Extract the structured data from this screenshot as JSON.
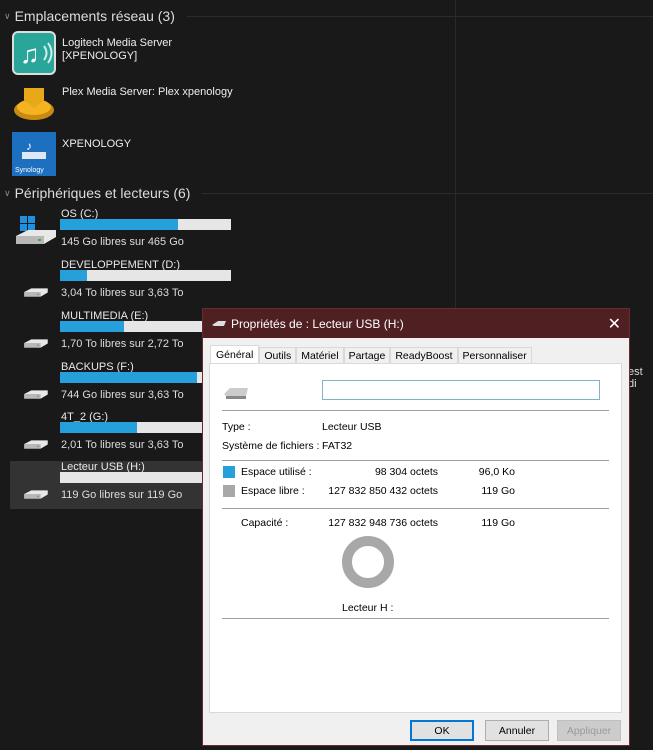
{
  "network": {
    "header": "Emplacements réseau (3)",
    "items": [
      {
        "line1": "Logitech Media Server",
        "line2": "[XPENOLOGY]",
        "icon": "logitech-media-icon"
      },
      {
        "label": "Plex Media Server: Plex xpenology",
        "icon": "plex-icon"
      },
      {
        "label": "XPENOLOGY",
        "icon": "synology-icon"
      }
    ]
  },
  "devices": {
    "header": "Périphériques et lecteurs (6)",
    "items": [
      {
        "label": "OS (C:)",
        "free": "145 Go libres sur 465 Go",
        "used_fraction": 0.69,
        "icon": "windows-drive-icon"
      },
      {
        "label": "DEVELOPPEMENT (D:)",
        "free": "3,04 To libres sur 3,63 To",
        "used_fraction": 0.16
      },
      {
        "label": "MULTIMEDIA (E:)",
        "free": "1,70 To libres sur 2,72 To",
        "used_fraction": 0.375
      },
      {
        "label": "BACKUPS (F:)",
        "free": "744 Go libres sur 3,63 To",
        "used_fraction": 0.8
      },
      {
        "label": "4T_2 (G:)",
        "free": "2,01 To libres sur 3,63 To",
        "used_fraction": 0.45
      },
      {
        "label": "Lecteur USB (H:)",
        "free": "119 Go libres sur 119 Go",
        "used_fraction": 0.0,
        "selected": true
      }
    ]
  },
  "background_fragment": "est di",
  "dialog": {
    "title": "Propriétés de : Lecteur USB (H:)",
    "tabs": [
      "Général",
      "Outils",
      "Matériel",
      "Partage",
      "ReadyBoost",
      "Personnaliser"
    ],
    "active_tab": "Général",
    "name_value": "",
    "type_label": "Type :",
    "type_value": "Lecteur USB",
    "fs_label": "Système de fichiers :",
    "fs_value": "FAT32",
    "used_label": "Espace utilisé :",
    "used_bytes": "98 304 octets",
    "used_human": "96,0 Ko",
    "free_label": "Espace libre :",
    "free_bytes": "127 832 850 432 octets",
    "free_human": "119 Go",
    "cap_label": "Capacité :",
    "cap_bytes": "127 832 948 736 octets",
    "cap_human": "119 Go",
    "drive_label": "Lecteur H :",
    "ok": "OK",
    "cancel": "Annuler",
    "apply": "Appliquer",
    "colors": {
      "used": "#26a0da",
      "free": "#a8a8a8",
      "titlebar": "#4f1f22"
    }
  }
}
